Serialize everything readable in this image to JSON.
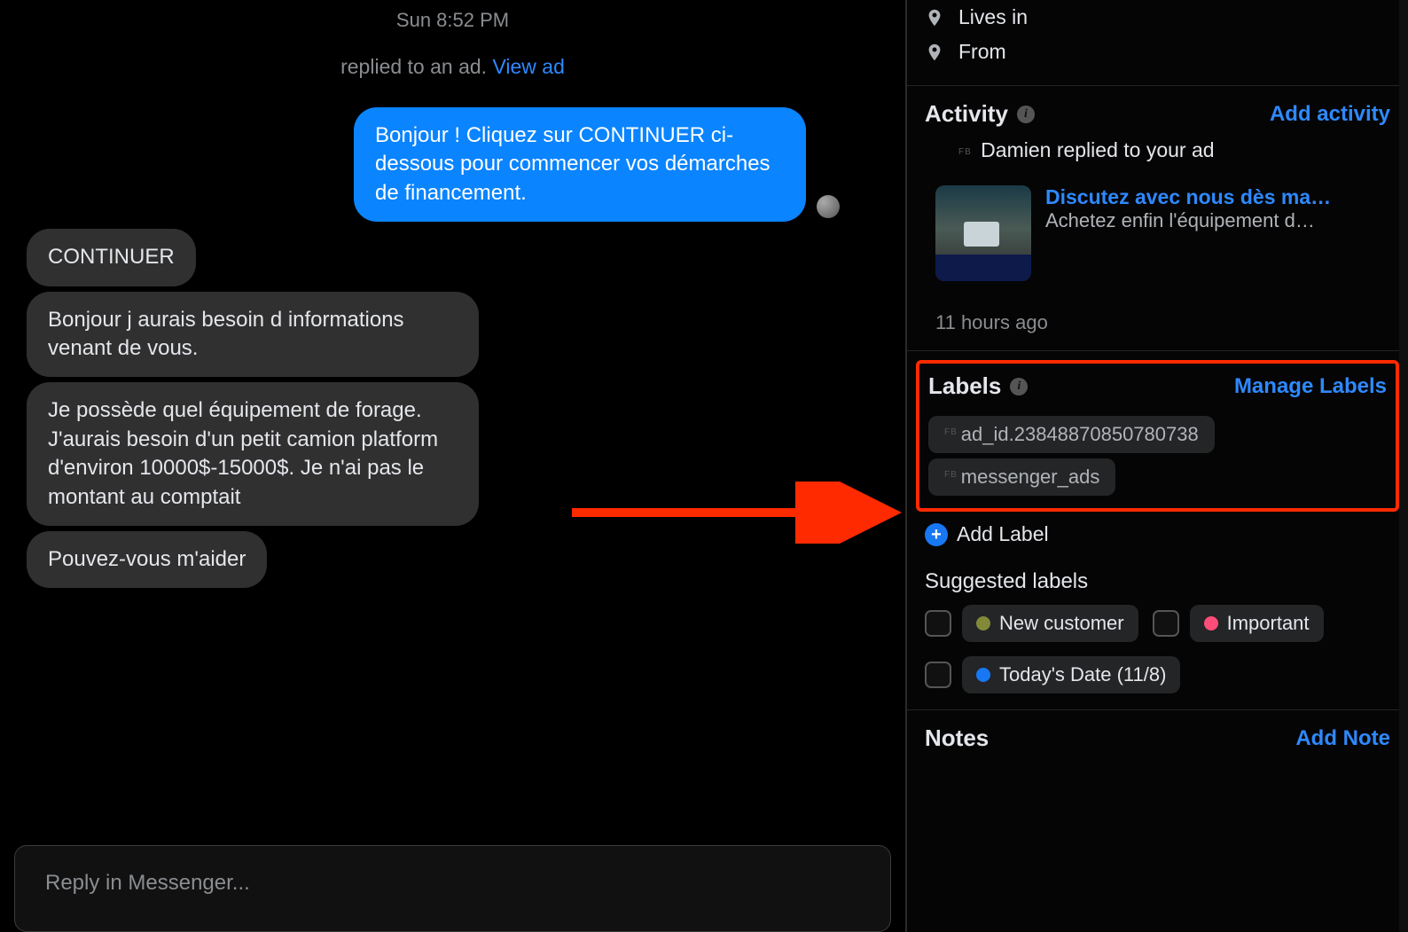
{
  "chat": {
    "timestamp": "Sun 8:52 PM",
    "ad_reply_prefix": "replied to an ad. ",
    "ad_reply_link": "View ad",
    "out_message": "Bonjour           ! Cliquez sur CONTINUER ci-dessous pour commencer vos démarches de financement.",
    "in_messages": [
      "CONTINUER",
      "Bonjour j aurais besoin d informations venant de vous.",
      "Je possède quel équipement de forage. J'aurais besoin d'un petit camion platform d'environ 10000$-15000$. Je n'ai pas le montant au comptait",
      "Pouvez-vous m'aider"
    ],
    "reply_placeholder": "Reply in Messenger..."
  },
  "profile": {
    "lives_in_label": "Lives in",
    "from_label": "From"
  },
  "activity": {
    "heading": "Activity",
    "action": "Add activity",
    "item": {
      "line": "Damien replied to your ad",
      "title": "Discutez avec nous dès ma…",
      "subtitle": "Achetez enfin l'équipement d…",
      "time": "11 hours ago"
    }
  },
  "labels": {
    "heading": "Labels",
    "action": "Manage Labels",
    "chips": [
      "ad_id.23848870850780738",
      "messenger_ads"
    ],
    "add_label": "Add Label",
    "suggested_heading": "Suggested labels",
    "suggested": [
      {
        "text": "New customer",
        "color": "olive"
      },
      {
        "text": "Important",
        "color": "pink"
      },
      {
        "text": "Today's Date (11/8)",
        "color": "blue"
      }
    ]
  },
  "notes": {
    "heading": "Notes",
    "action": "Add Note"
  }
}
